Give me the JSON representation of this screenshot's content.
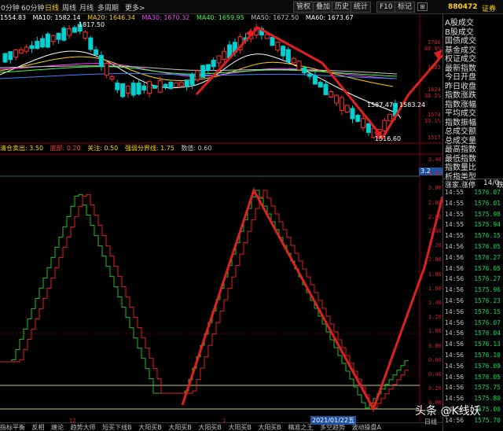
{
  "toolbar": {
    "tabs": [
      "0分钟",
      "60分钟",
      "日线",
      "周线",
      "月线",
      "多周期",
      "更多>"
    ],
    "active_tab": "日线",
    "code": "880472",
    "code_name": "证券",
    "buttons": [
      "管权",
      "叠加",
      "历史",
      "统计",
      "F10",
      "标记"
    ]
  },
  "ma_line": {
    "price": "1554.83",
    "ma10_label": "MA10:",
    "ma10_value": "1582.14",
    "ma20_label": "MA20:",
    "ma20_value": "1646.34",
    "ma30_label": "MA30:",
    "ma30_value": "1670.32",
    "ma40_label": "MA40:",
    "ma40_value": "1659.95",
    "ma50_label": "MA50:",
    "ma50_value": "1672.50",
    "ma60_label": "MA60:",
    "ma60_value": "1673.67"
  },
  "price_chart": {
    "high_label": "1817.50",
    "low_label": "1516.60",
    "mid_label": "1587.47 - 1583.24",
    "axis": [
      "1760",
      "80.9%",
      "1692",
      "1624",
      "38.2%",
      "1574",
      "19.1%",
      "1517"
    ]
  },
  "indicator_line": {
    "a": "清仓卖出: 3.50",
    "b": "底部: 0.20",
    "c": "关注: 0.50",
    "d": "强弱分界线: 1.75",
    "e": "数值: 0.60",
    "marker": "3.2"
  },
  "indicator_axis": [
    "3.40",
    "3.20",
    "3.00",
    "2.80",
    "2.60",
    "2.40",
    "2.20",
    "2.00",
    "1.80",
    "1.60",
    "1.40",
    "1.20",
    "1.00",
    "0.80",
    "0.60",
    "0.40",
    "0.20",
    "0.00"
  ],
  "sidebar_menu": [
    "A股成交",
    "B股成交",
    "国债成交",
    "基金成交",
    "权证成交",
    "最新指数",
    "今日开盘",
    "昨日收盘",
    "指数涨跌",
    "指数涨幅",
    "平均成交",
    "指数振幅",
    "总成交额",
    "总成交量",
    "最高指数",
    "最低指数",
    "指数量比",
    "析指类型"
  ],
  "sidebar_extra": {
    "label": "涨家.涨停",
    "value": "14/0",
    "trend": "跌"
  },
  "ticks": [
    {
      "t": "14:55",
      "p": "1576.07"
    },
    {
      "t": "14:55",
      "p": "1576.01"
    },
    {
      "t": "14:55",
      "p": "1575.98"
    },
    {
      "t": "14:55",
      "p": "1575.94"
    },
    {
      "t": "14:55",
      "p": "1576.15"
    },
    {
      "t": "14:56",
      "p": "1576.05"
    },
    {
      "t": "14:56",
      "p": "1576.27"
    },
    {
      "t": "14:56",
      "p": "1576.05"
    },
    {
      "t": "14:56",
      "p": "1576.27"
    },
    {
      "t": "14:56",
      "p": "1575.96"
    },
    {
      "t": "14:56",
      "p": "1576.23"
    },
    {
      "t": "14:56",
      "p": "1576.15"
    },
    {
      "t": "14:56",
      "p": "1576.07"
    },
    {
      "t": "14:56",
      "p": "1576.04"
    },
    {
      "t": "14:56",
      "p": "1576.13"
    },
    {
      "t": "14:56",
      "p": "1576.10"
    },
    {
      "t": "14:56",
      "p": "1576.09"
    },
    {
      "t": "14:56",
      "p": "1576.05"
    },
    {
      "t": "14:56",
      "p": "1575.75"
    },
    {
      "t": "14:56",
      "p": "1575.80"
    },
    {
      "t": "14:56",
      "p": "1575.00"
    },
    {
      "t": "14:56",
      "p": "1575.70"
    }
  ],
  "bottom": {
    "date": "2021/01/22五",
    "tabs": [
      "指标平衡",
      "反相",
      "缠论",
      "趋势大师",
      "短买下线B",
      "大阳买B",
      "大阳买B",
      "大阳买B",
      "大阳买B",
      "大阳买B",
      "精准之王",
      "多空趋势",
      "波动操盘A"
    ],
    "month_label": "12",
    "month_label2": "1",
    "day_view": "日线"
  },
  "watermark": "头条 @K线妖",
  "colors": {
    "up": "#e02020",
    "down": "#00e0e0",
    "green": "#20c020",
    "arrow": "#e02020"
  }
}
